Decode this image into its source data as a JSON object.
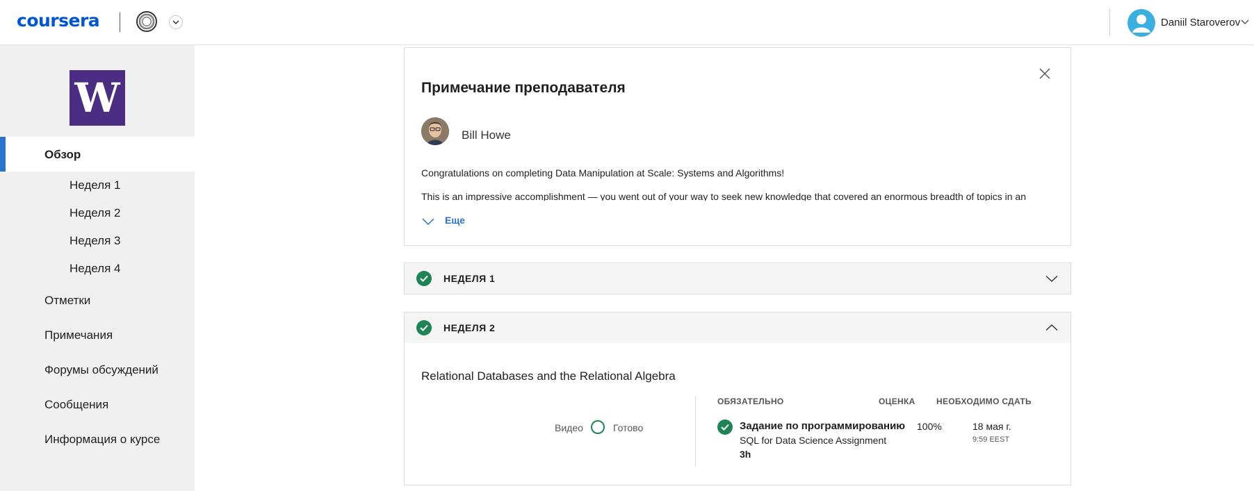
{
  "header": {
    "logo_text": "coursera",
    "user_name": "Daniil Staroverov"
  },
  "sidebar": {
    "nav": [
      {
        "label": "Обзор",
        "active": true
      },
      {
        "label": "Неделя 1"
      },
      {
        "label": "Неделя 2"
      },
      {
        "label": "Неделя 3"
      },
      {
        "label": "Неделя 4"
      },
      {
        "label": "Отметки"
      },
      {
        "label": "Примечания"
      },
      {
        "label": "Форумы обсуждений"
      },
      {
        "label": "Сообщения"
      },
      {
        "label": "Информация о курсе"
      }
    ],
    "logo_letter": "W"
  },
  "note": {
    "title": "Примечание преподавателя",
    "instructor": "Bill Howe",
    "p1": "Congratulations on completing Data Manipulation at Scale: Systems and Algorithms!",
    "p2": "This is an impressive accomplishment — you went out of your way to seek new knowledge that covered an enormous breadth of topics in an",
    "more_label": "Еще"
  },
  "weeks": [
    {
      "label": "НЕДЕЛЯ 1",
      "completed": true,
      "expanded": false
    },
    {
      "label": "НЕДЕЛЯ 2",
      "completed": true,
      "expanded": true
    }
  ],
  "week2": {
    "module_title": "Relational Databases and the Relational Algebra",
    "video_label": "Видео",
    "done_label": "Готово",
    "columns": {
      "required": "ОБЯЗАТЕЛЬНО",
      "grade": "ОЦЕНКА",
      "due": "НЕОБХОДИМО СДАТЬ"
    },
    "assignment": {
      "type": "Задание по программированию",
      "name": "SQL for Data Science Assignment",
      "duration": "3h",
      "grade": "100%",
      "due_date": "18 мая г.",
      "due_time": "9:59 EEST"
    }
  },
  "colors": {
    "brand_blue": "#0056d2",
    "link_blue": "#2a73cc",
    "success_green": "#1f8354",
    "uw_purple": "#4b2e83",
    "avatar_blue": "#3bb0e0"
  }
}
